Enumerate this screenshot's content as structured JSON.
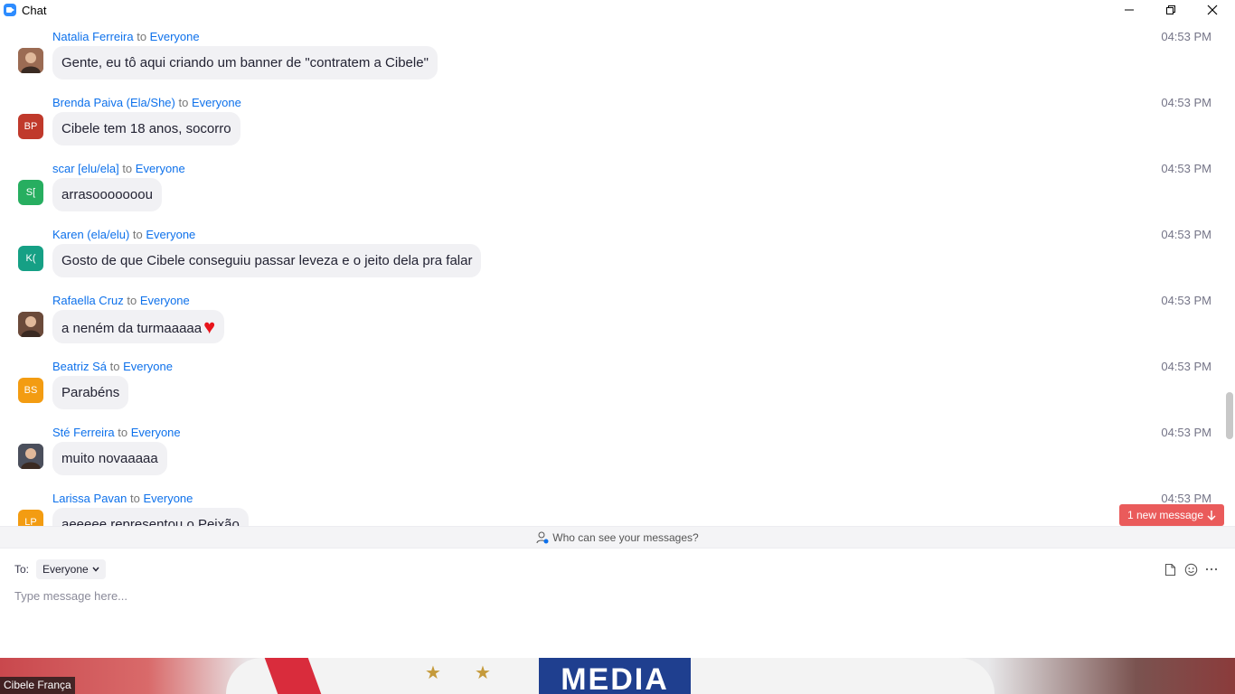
{
  "window": {
    "title": "Chat"
  },
  "messages": [
    {
      "sender": "Natalia Ferreira",
      "to_word": "to",
      "recipient": "Everyone",
      "time": "04:53 PM",
      "text": "Gente, eu tô aqui criando um banner de \"contratem a Cibele\"",
      "avatar_initials": "",
      "avatar_type": "photo",
      "avatar_color": "#9b6b53"
    },
    {
      "sender": "Brenda Paiva (Ela/She)",
      "to_word": "to",
      "recipient": "Everyone",
      "time": "04:53 PM",
      "text": "Cibele tem 18 anos, socorro",
      "avatar_initials": "BP",
      "avatar_type": "initials",
      "avatar_color": "#c0392b"
    },
    {
      "sender": "scar [elu/ela]",
      "to_word": "to",
      "recipient": "Everyone",
      "time": "04:53 PM",
      "text": "arrasooooooou",
      "avatar_initials": "S[",
      "avatar_type": "initials",
      "avatar_color": "#27ae60"
    },
    {
      "sender": "Karen (ela/elu)",
      "to_word": "to",
      "recipient": "Everyone",
      "time": "04:53 PM",
      "text": "Gosto de que Cibele conseguiu passar leveza e o jeito dela pra falar",
      "avatar_initials": "K(",
      "avatar_type": "initials",
      "avatar_color": "#16a085"
    },
    {
      "sender": "Rafaella Cruz",
      "to_word": "to",
      "recipient": "Everyone",
      "time": "04:53 PM",
      "text": "a neném da turmaaaaa",
      "emoji": "♥",
      "avatar_initials": "",
      "avatar_type": "photo",
      "avatar_color": "#6b4a3a"
    },
    {
      "sender": "Beatriz Sá",
      "to_word": "to",
      "recipient": "Everyone",
      "time": "04:53 PM",
      "text": "Parabéns",
      "avatar_initials": "BS",
      "avatar_type": "initials",
      "avatar_color": "#f39c12"
    },
    {
      "sender": "Sté Ferreira",
      "to_word": "to",
      "recipient": "Everyone",
      "time": "04:53 PM",
      "text": "muito novaaaaa",
      "avatar_initials": "",
      "avatar_type": "photo",
      "avatar_color": "#4b4f5c"
    },
    {
      "sender": "Larissa Pavan",
      "to_word": "to",
      "recipient": "Everyone",
      "time": "04:53 PM",
      "text": "aeeeee representou o Peixão",
      "avatar_initials": "LP",
      "avatar_type": "initials",
      "avatar_color": "#f39c12"
    }
  ],
  "new_message_button": {
    "label": "1 new message"
  },
  "privacy": {
    "text": "Who can see your messages?"
  },
  "composer": {
    "to_label": "To:",
    "recipient": "Everyone",
    "placeholder": "Type message here..."
  },
  "video": {
    "participant_name": "Cibele França",
    "shirt_text": "MEDIA"
  },
  "colors": {
    "accent": "#0e71eb",
    "new_message": "#ea5b5b",
    "bubble": "#f1f1f4"
  }
}
